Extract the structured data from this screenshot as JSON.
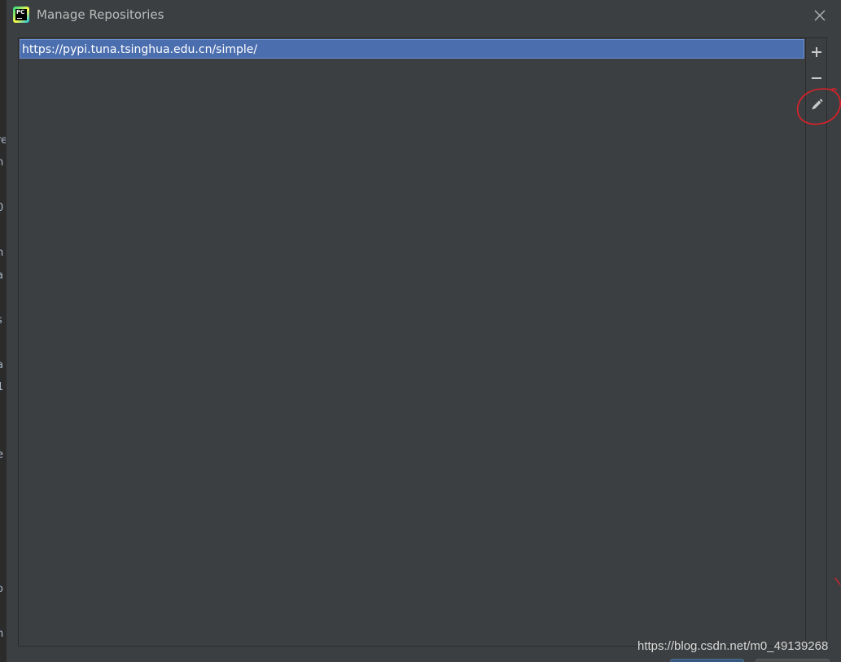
{
  "window": {
    "title": "Manage Repositories",
    "app_icon_text": "PC"
  },
  "background_ide": {
    "fragments": [
      "re",
      "h",
      "0",
      "n",
      "a",
      "s",
      "a",
      "1",
      "e",
      "o",
      "n"
    ]
  },
  "repositories": {
    "items": [
      {
        "url": "https://pypi.tuna.tsinghua.edu.cn/simple/",
        "selected": true
      }
    ]
  },
  "toolbar": {
    "add_icon": "plus-icon",
    "remove_icon": "minus-icon",
    "edit_icon": "pencil-icon"
  },
  "colors": {
    "dialog_bg": "#3c3f41",
    "selection_bg": "#4b6eaf",
    "title_text": "#bbbbbb",
    "annotation_red": "#e0202a",
    "ok_button_blue": "#365880"
  },
  "watermark": "https://blog.csdn.net/m0_49139268"
}
